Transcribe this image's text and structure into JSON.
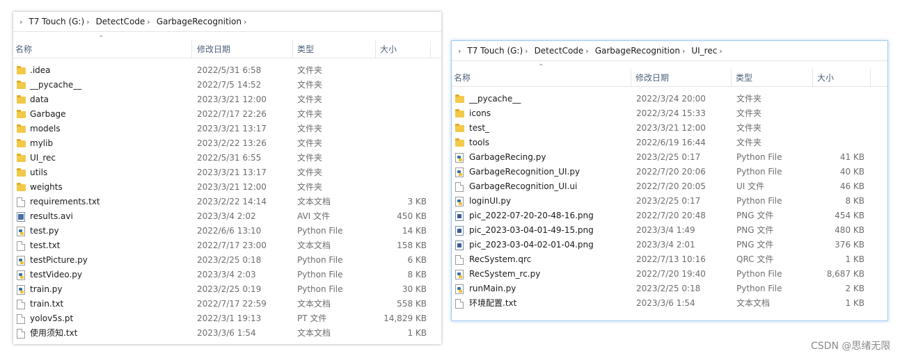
{
  "left_window": {
    "breadcrumb": [
      "T7 Touch (G:)",
      "DetectCode",
      "GarbageRecognition"
    ],
    "columns": {
      "name": "名称",
      "date": "修改日期",
      "type": "类型",
      "size": "大小"
    },
    "rows": [
      {
        "icon": "folder-icon",
        "name": ".idea",
        "date": "2022/5/31 6:58",
        "type": "文件夹",
        "size": ""
      },
      {
        "icon": "folder-icon",
        "name": "__pycache__",
        "date": "2022/7/5 14:52",
        "type": "文件夹",
        "size": ""
      },
      {
        "icon": "folder-icon",
        "name": "data",
        "date": "2023/3/21 12:00",
        "type": "文件夹",
        "size": ""
      },
      {
        "icon": "folder-icon",
        "name": "Garbage",
        "date": "2022/7/17 22:26",
        "type": "文件夹",
        "size": ""
      },
      {
        "icon": "folder-icon",
        "name": "models",
        "date": "2023/3/21 13:17",
        "type": "文件夹",
        "size": ""
      },
      {
        "icon": "folder-icon",
        "name": "mylib",
        "date": "2023/2/22 13:26",
        "type": "文件夹",
        "size": ""
      },
      {
        "icon": "folder-icon",
        "name": "UI_rec",
        "date": "2022/5/31 6:55",
        "type": "文件夹",
        "size": ""
      },
      {
        "icon": "folder-icon",
        "name": "utils",
        "date": "2023/3/21 13:17",
        "type": "文件夹",
        "size": ""
      },
      {
        "icon": "folder-icon",
        "name": "weights",
        "date": "2023/3/21 12:00",
        "type": "文件夹",
        "size": ""
      },
      {
        "icon": "text-file-icon",
        "name": "requirements.txt",
        "date": "2023/2/22 14:14",
        "type": "文本文档",
        "size": "3 KB"
      },
      {
        "icon": "video-file-icon",
        "name": "results.avi",
        "date": "2023/3/4 2:02",
        "type": "AVI 文件",
        "size": "450 KB"
      },
      {
        "icon": "python-file-icon",
        "name": "test.py",
        "date": "2022/6/6 13:10",
        "type": "Python File",
        "size": "14 KB"
      },
      {
        "icon": "text-file-icon",
        "name": "test.txt",
        "date": "2022/7/17 23:00",
        "type": "文本文档",
        "size": "158 KB"
      },
      {
        "icon": "python-file-icon",
        "name": "testPicture.py",
        "date": "2023/2/25 0:18",
        "type": "Python File",
        "size": "6 KB"
      },
      {
        "icon": "python-file-icon",
        "name": "testVideo.py",
        "date": "2023/3/4 2:03",
        "type": "Python File",
        "size": "8 KB"
      },
      {
        "icon": "python-file-icon",
        "name": "train.py",
        "date": "2023/2/25 0:19",
        "type": "Python File",
        "size": "30 KB"
      },
      {
        "icon": "text-file-icon",
        "name": "train.txt",
        "date": "2022/7/17 22:59",
        "type": "文本文档",
        "size": "558 KB"
      },
      {
        "icon": "generic-file-icon",
        "name": "yolov5s.pt",
        "date": "2022/3/1 19:13",
        "type": "PT 文件",
        "size": "14,829 KB"
      },
      {
        "icon": "text-file-icon",
        "name": "使用须知.txt",
        "date": "2023/3/6 1:54",
        "type": "文本文档",
        "size": "1 KB"
      }
    ]
  },
  "right_window": {
    "breadcrumb": [
      "T7 Touch (G:)",
      "DetectCode",
      "GarbageRecognition",
      "UI_rec"
    ],
    "columns": {
      "name": "名称",
      "date": "修改日期",
      "type": "类型",
      "size": "大小"
    },
    "rows": [
      {
        "icon": "folder-icon",
        "name": "__pycache__",
        "date": "2022/3/24 20:00",
        "type": "文件夹",
        "size": ""
      },
      {
        "icon": "folder-icon",
        "name": "icons",
        "date": "2022/3/24 15:33",
        "type": "文件夹",
        "size": ""
      },
      {
        "icon": "folder-icon",
        "name": "test_",
        "date": "2023/3/21 12:00",
        "type": "文件夹",
        "size": ""
      },
      {
        "icon": "folder-icon",
        "name": "tools",
        "date": "2022/6/19 16:44",
        "type": "文件夹",
        "size": ""
      },
      {
        "icon": "python-file-icon",
        "name": "GarbageRecing.py",
        "date": "2023/2/25 0:17",
        "type": "Python File",
        "size": "41 KB"
      },
      {
        "icon": "python-file-icon",
        "name": "GarbageRecognition_UI.py",
        "date": "2022/7/20 20:06",
        "type": "Python File",
        "size": "40 KB"
      },
      {
        "icon": "generic-file-icon",
        "name": "GarbageRecognition_UI.ui",
        "date": "2022/7/20 20:05",
        "type": "UI 文件",
        "size": "46 KB"
      },
      {
        "icon": "python-file-icon",
        "name": "loginUI.py",
        "date": "2023/2/25 0:17",
        "type": "Python File",
        "size": "8 KB"
      },
      {
        "icon": "image-file-icon",
        "name": "pic_2022-07-20-20-48-16.png",
        "date": "2022/7/20 20:48",
        "type": "PNG 文件",
        "size": "454 KB"
      },
      {
        "icon": "image-file-icon",
        "name": "pic_2023-03-04-01-49-15.png",
        "date": "2023/3/4 1:49",
        "type": "PNG 文件",
        "size": "480 KB"
      },
      {
        "icon": "image-file-icon",
        "name": "pic_2023-03-04-02-01-04.png",
        "date": "2023/3/4 2:01",
        "type": "PNG 文件",
        "size": "376 KB"
      },
      {
        "icon": "generic-file-icon",
        "name": "RecSystem.qrc",
        "date": "2022/7/13 10:16",
        "type": "QRC 文件",
        "size": "1 KB"
      },
      {
        "icon": "python-file-icon",
        "name": "RecSystem_rc.py",
        "date": "2022/7/20 19:40",
        "type": "Python File",
        "size": "8,687 KB"
      },
      {
        "icon": "python-file-icon",
        "name": "runMain.py",
        "date": "2023/2/25 0:18",
        "type": "Python File",
        "size": "2 KB"
      },
      {
        "icon": "text-file-icon",
        "name": "环境配置.txt",
        "date": "2023/3/6 1:54",
        "type": "文本文档",
        "size": "1 KB"
      }
    ]
  },
  "watermark": "CSDN @思绪无限"
}
